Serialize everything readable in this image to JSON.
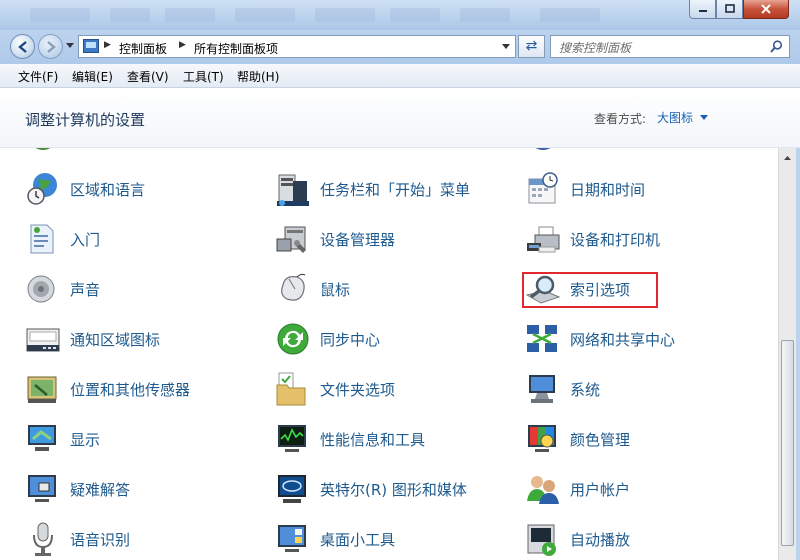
{
  "window": {
    "address_crumbs": [
      "控制面板",
      "所有控制面板项"
    ],
    "search_placeholder": "搜索控制面板"
  },
  "menu": [
    "文件(F)",
    "编辑(E)",
    "查看(V)",
    "工具(T)",
    "帮助(H)"
  ],
  "header": {
    "title": "调整计算机的设置",
    "view_label": "查看方式:",
    "view_value": "大图标"
  },
  "items": [
    [
      {
        "label": "区域和语言",
        "icon": "globe-clock-icon"
      },
      {
        "label": "任务栏和「开始」菜单",
        "icon": "taskbar-icon"
      },
      {
        "label": "日期和时间",
        "icon": "calendar-clock-icon"
      }
    ],
    [
      {
        "label": "入门",
        "icon": "document-icon"
      },
      {
        "label": "设备管理器",
        "icon": "device-manager-icon"
      },
      {
        "label": "设备和打印机",
        "icon": "printer-icon"
      }
    ],
    [
      {
        "label": "声音",
        "icon": "speaker-icon"
      },
      {
        "label": "鼠标",
        "icon": "mouse-icon"
      },
      {
        "label": "索引选项",
        "icon": "magnifier-icon"
      }
    ],
    [
      {
        "label": "通知区域图标",
        "icon": "notification-tray-icon"
      },
      {
        "label": "同步中心",
        "icon": "sync-icon"
      },
      {
        "label": "网络和共享中心",
        "icon": "network-icon"
      }
    ],
    [
      {
        "label": "位置和其他传感器",
        "icon": "sensor-icon"
      },
      {
        "label": "文件夹选项",
        "icon": "folder-icon"
      },
      {
        "label": "系统",
        "icon": "system-icon"
      }
    ],
    [
      {
        "label": "显示",
        "icon": "display-icon"
      },
      {
        "label": "性能信息和工具",
        "icon": "performance-icon"
      },
      {
        "label": "颜色管理",
        "icon": "color-management-icon"
      }
    ],
    [
      {
        "label": "疑难解答",
        "icon": "troubleshoot-icon"
      },
      {
        "label": "英特尔(R) 图形和媒体",
        "icon": "intel-graphics-icon"
      },
      {
        "label": "用户帐户",
        "icon": "user-accounts-icon"
      }
    ],
    [
      {
        "label": "语音识别",
        "icon": "microphone-icon"
      },
      {
        "label": "桌面小工具",
        "icon": "gadgets-icon"
      },
      {
        "label": "自动播放",
        "icon": "autoplay-icon"
      }
    ]
  ],
  "highlighted_item": "索引选项"
}
